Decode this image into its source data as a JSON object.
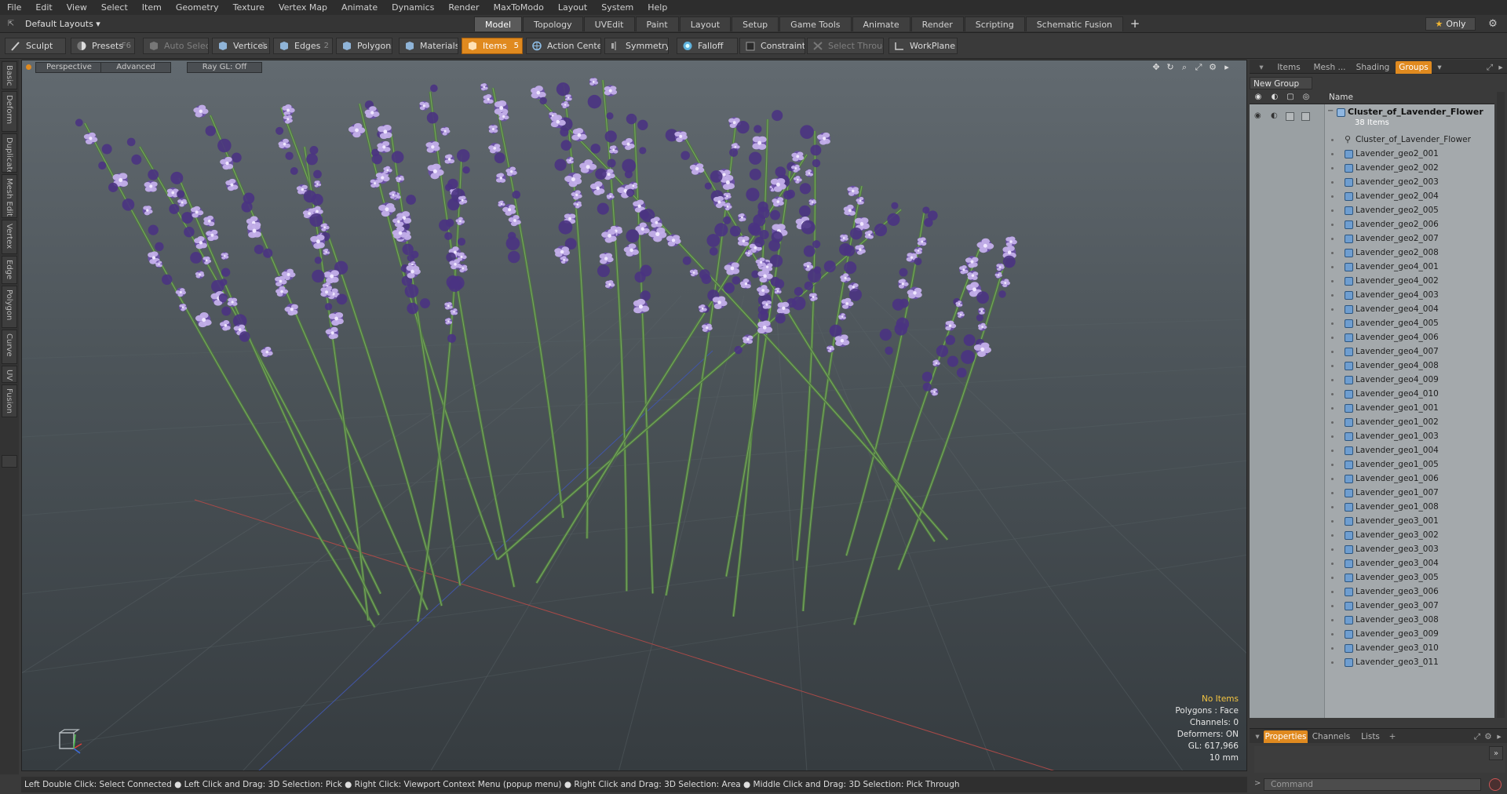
{
  "menu": [
    "File",
    "Edit",
    "View",
    "Select",
    "Item",
    "Geometry",
    "Texture",
    "Vertex Map",
    "Animate",
    "Dynamics",
    "Render",
    "MaxToModo",
    "Layout",
    "System",
    "Help"
  ],
  "layout_select": "Default Layouts ▾",
  "tabs": [
    "Model",
    "Topology",
    "UVEdit",
    "Paint",
    "Layout",
    "Setup",
    "Game Tools",
    "Animate",
    "Render",
    "Scripting",
    "Schematic Fusion"
  ],
  "active_tab": "Model",
  "only_label": "Only",
  "toolbar": {
    "sculpt": "Sculpt",
    "presets": "Presets",
    "presets_key": "F6",
    "auto_select": "Auto Select",
    "vertices": "Vertices",
    "vertices_key": "1",
    "edges": "Edges",
    "edges_key": "2",
    "polygons": "Polygons",
    "materials": "Materials",
    "items": "Items",
    "items_key": "5",
    "action_center": "Action Center",
    "symmetry": "Symmetry",
    "falloff": "Falloff",
    "constraints": "Constraints",
    "select_through": "Select Through",
    "workplane": "WorkPlane"
  },
  "left_tabs": [
    "Basic",
    "Deform",
    "Duplicate",
    "Mesh Edit",
    "Vertex",
    "Edge",
    "Polygon",
    "Curve",
    "UV",
    "Fusion"
  ],
  "viewport": {
    "perspective": "Perspective",
    "advanced": "Advanced",
    "raygl": "Ray GL: Off",
    "info": {
      "no_items": "No Items",
      "polygons": "Polygons : Face",
      "channels": "Channels: 0",
      "deformers": "Deformers: ON",
      "gl": "GL: 617,966",
      "units": "10 mm"
    }
  },
  "status": "Left Double Click: Select Connected ● Left Click and Drag: 3D Selection: Pick ● Right Click: Viewport Context Menu (popup menu) ● Right Click and Drag: 3D Selection: Area ● Middle Click and Drag: 3D Selection: Pick Through",
  "right_panel": {
    "tabs": [
      "Items",
      "Mesh ...",
      "Shading",
      "Groups"
    ],
    "active_tab": "Groups",
    "new_group": "New Group",
    "name_col": "Name",
    "group_name": "Cluster_of_Lavender_Flower",
    "group_count": "38 Items",
    "items": [
      "Cluster_of_Lavender_Flower",
      "Lavender_geo2_001",
      "Lavender_geo2_002",
      "Lavender_geo2_003",
      "Lavender_geo2_004",
      "Lavender_geo2_005",
      "Lavender_geo2_006",
      "Lavender_geo2_007",
      "Lavender_geo2_008",
      "Lavender_geo4_001",
      "Lavender_geo4_002",
      "Lavender_geo4_003",
      "Lavender_geo4_004",
      "Lavender_geo4_005",
      "Lavender_geo4_006",
      "Lavender_geo4_007",
      "Lavender_geo4_008",
      "Lavender_geo4_009",
      "Lavender_geo4_010",
      "Lavender_geo1_001",
      "Lavender_geo1_002",
      "Lavender_geo1_003",
      "Lavender_geo1_004",
      "Lavender_geo1_005",
      "Lavender_geo1_006",
      "Lavender_geo1_007",
      "Lavender_geo1_008",
      "Lavender_geo3_001",
      "Lavender_geo3_002",
      "Lavender_geo3_003",
      "Lavender_geo3_004",
      "Lavender_geo3_005",
      "Lavender_geo3_006",
      "Lavender_geo3_007",
      "Lavender_geo3_008",
      "Lavender_geo3_009",
      "Lavender_geo3_010",
      "Lavender_geo3_011"
    ],
    "props_tabs": [
      "Properties",
      "Channels",
      "Lists"
    ],
    "active_props_tab": "Properties",
    "command_placeholder": "Command"
  },
  "colors": {
    "accent": "#e08a1f",
    "stem": "#5f8a4a",
    "flower_dark": "#5a3f91",
    "flower_light": "#b9a3e3"
  }
}
